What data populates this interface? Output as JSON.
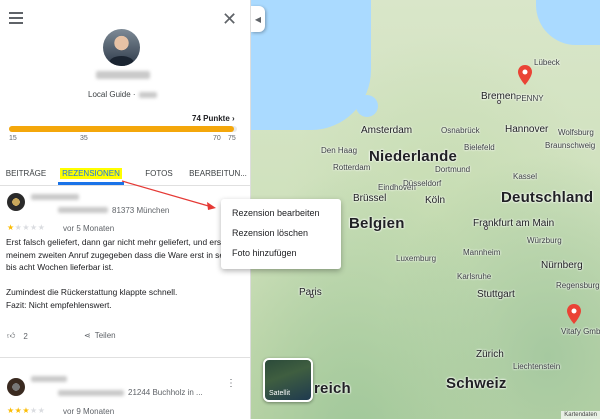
{
  "panel": {
    "guide_label": "Local Guide ·",
    "points": "74 Punkte",
    "points_chevron": "›",
    "progress": {
      "value": 74,
      "max": 75
    },
    "ticks": [
      "15",
      "35",
      "70",
      "75"
    ],
    "tabs": [
      {
        "label": "BEITRÄGE"
      },
      {
        "label": "REZENSIONEN"
      },
      {
        "label": "FOTOS"
      },
      {
        "label": "BEARBEITUN..."
      }
    ]
  },
  "reviews": [
    {
      "address": "81373 München",
      "rating": 1,
      "ago": "vor 5 Monaten",
      "text": "Erst falsch geliefert, dann gar nicht mehr geliefert, und erst nach meinem zweiten Anruf zugegeben dass die Ware erst in sechs bis acht Wochen lieferbar ist.\n\nZumindest die Rückerstattung klappte schnell.\nFazit: Nicht empfehlenswert.",
      "likes": "2",
      "share_label": "Teilen"
    },
    {
      "address": "21244 Buchholz in ...",
      "rating": 3,
      "ago": "vor 9 Monaten"
    }
  ],
  "menu": {
    "items": [
      {
        "label": "Rezension bearbeiten"
      },
      {
        "label": "Rezension löschen"
      },
      {
        "label": "Foto hinzufügen"
      }
    ]
  },
  "map": {
    "labels": {
      "country_nl": "Niederlande",
      "country_be": "Belgien",
      "country_de": "Deutschland",
      "country_ch": "Schweiz",
      "country_at_part": "reich",
      "amsterdam": "Amsterdam",
      "denhaag": "Den Haag",
      "rotterdam": "Rotterdam",
      "eindhoven": "Eindhoven",
      "bremen": "Bremen",
      "hannover": "Hannover",
      "wolfsburg": "Wolfsburg",
      "braunschweig": "Braunschweig",
      "dortmund": "Dortmund",
      "duesseldorf": "Düsseldorf",
      "koeln": "Köln",
      "kassel": "Kassel",
      "bruessel": "Brüssel",
      "frankfurt": "Frankfurt am Main",
      "luxemburg": "Luxemburg",
      "mannheim": "Mannheim",
      "nuernberg": "Nürnberg",
      "stuttgart": "Stuttgart",
      "paris": "Paris",
      "zuerich": "Zürich",
      "liechtenstein": "Liechtenstein",
      "luebeck": "Lübeck",
      "penny": "PENNY",
      "vitafy": "Vitafy GmbH",
      "osnabrueck": "Osnabrück",
      "bielefeld": "Bielefeld",
      "wuerzburg": "Würzburg",
      "regensburg": "Regensburg",
      "karlsruhe": "Karlsruhe"
    },
    "satellite_label": "Satellit",
    "footer": "Kartendaten"
  }
}
